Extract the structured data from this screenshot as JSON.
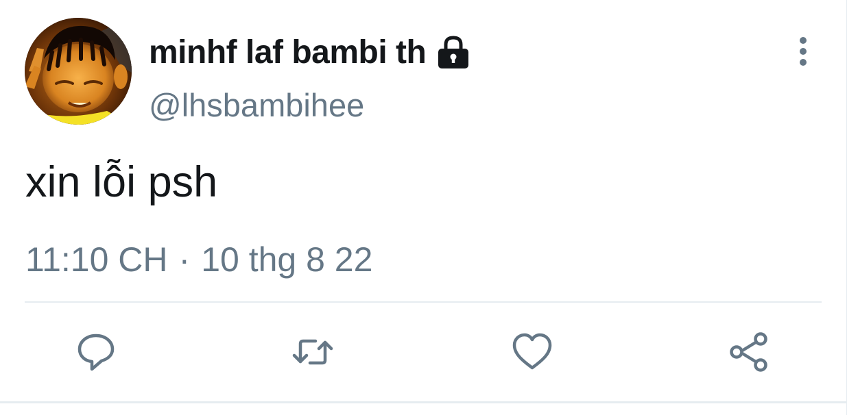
{
  "tweet": {
    "display_name": "minhf laf bambi th",
    "handle": "@lhsbambihee",
    "text": "xin lỗi psh",
    "time": "11:10 CH",
    "separator": "·",
    "date": "10 thg 8 22",
    "protected": true
  },
  "icons": {
    "lock": "lock-icon",
    "more": "more-vertical-icon",
    "reply": "reply-icon",
    "retweet": "retweet-icon",
    "like": "heart-icon",
    "share": "share-icon"
  },
  "colors": {
    "primary_text": "#14171a",
    "secondary_text": "#657786",
    "icon": "#657786",
    "divider": "#e6ecf0"
  }
}
